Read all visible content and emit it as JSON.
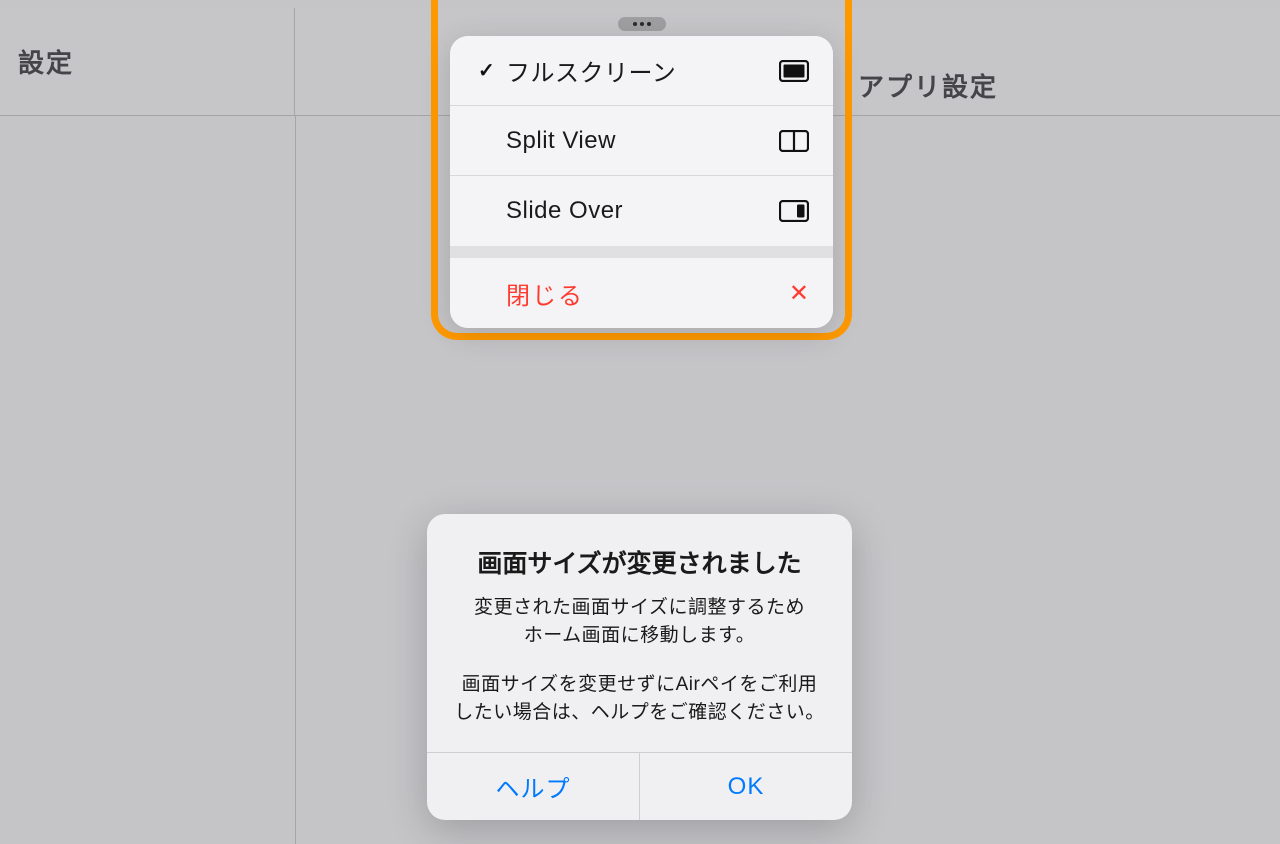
{
  "sidebar": {
    "title": "設定"
  },
  "header": {
    "app_settings": "アプリ設定"
  },
  "multitask_menu": {
    "items": [
      {
        "label": "フルスクリーン",
        "checked": true,
        "icon": "fullscreen"
      },
      {
        "label": "Split View",
        "checked": false,
        "icon": "splitview"
      },
      {
        "label": "Slide Over",
        "checked": false,
        "icon": "slideover"
      }
    ],
    "close_label": "閉じる"
  },
  "alert": {
    "title": "画面サイズが変更されました",
    "line1": "変更された画面サイズに調整するため",
    "line2": "ホーム画面に移動します。",
    "line3": "画面サイズを変更せずにAirペイをご利用",
    "line4": "したい場合は、ヘルプをご確認ください。",
    "help_label": "ヘルプ",
    "ok_label": "OK"
  }
}
